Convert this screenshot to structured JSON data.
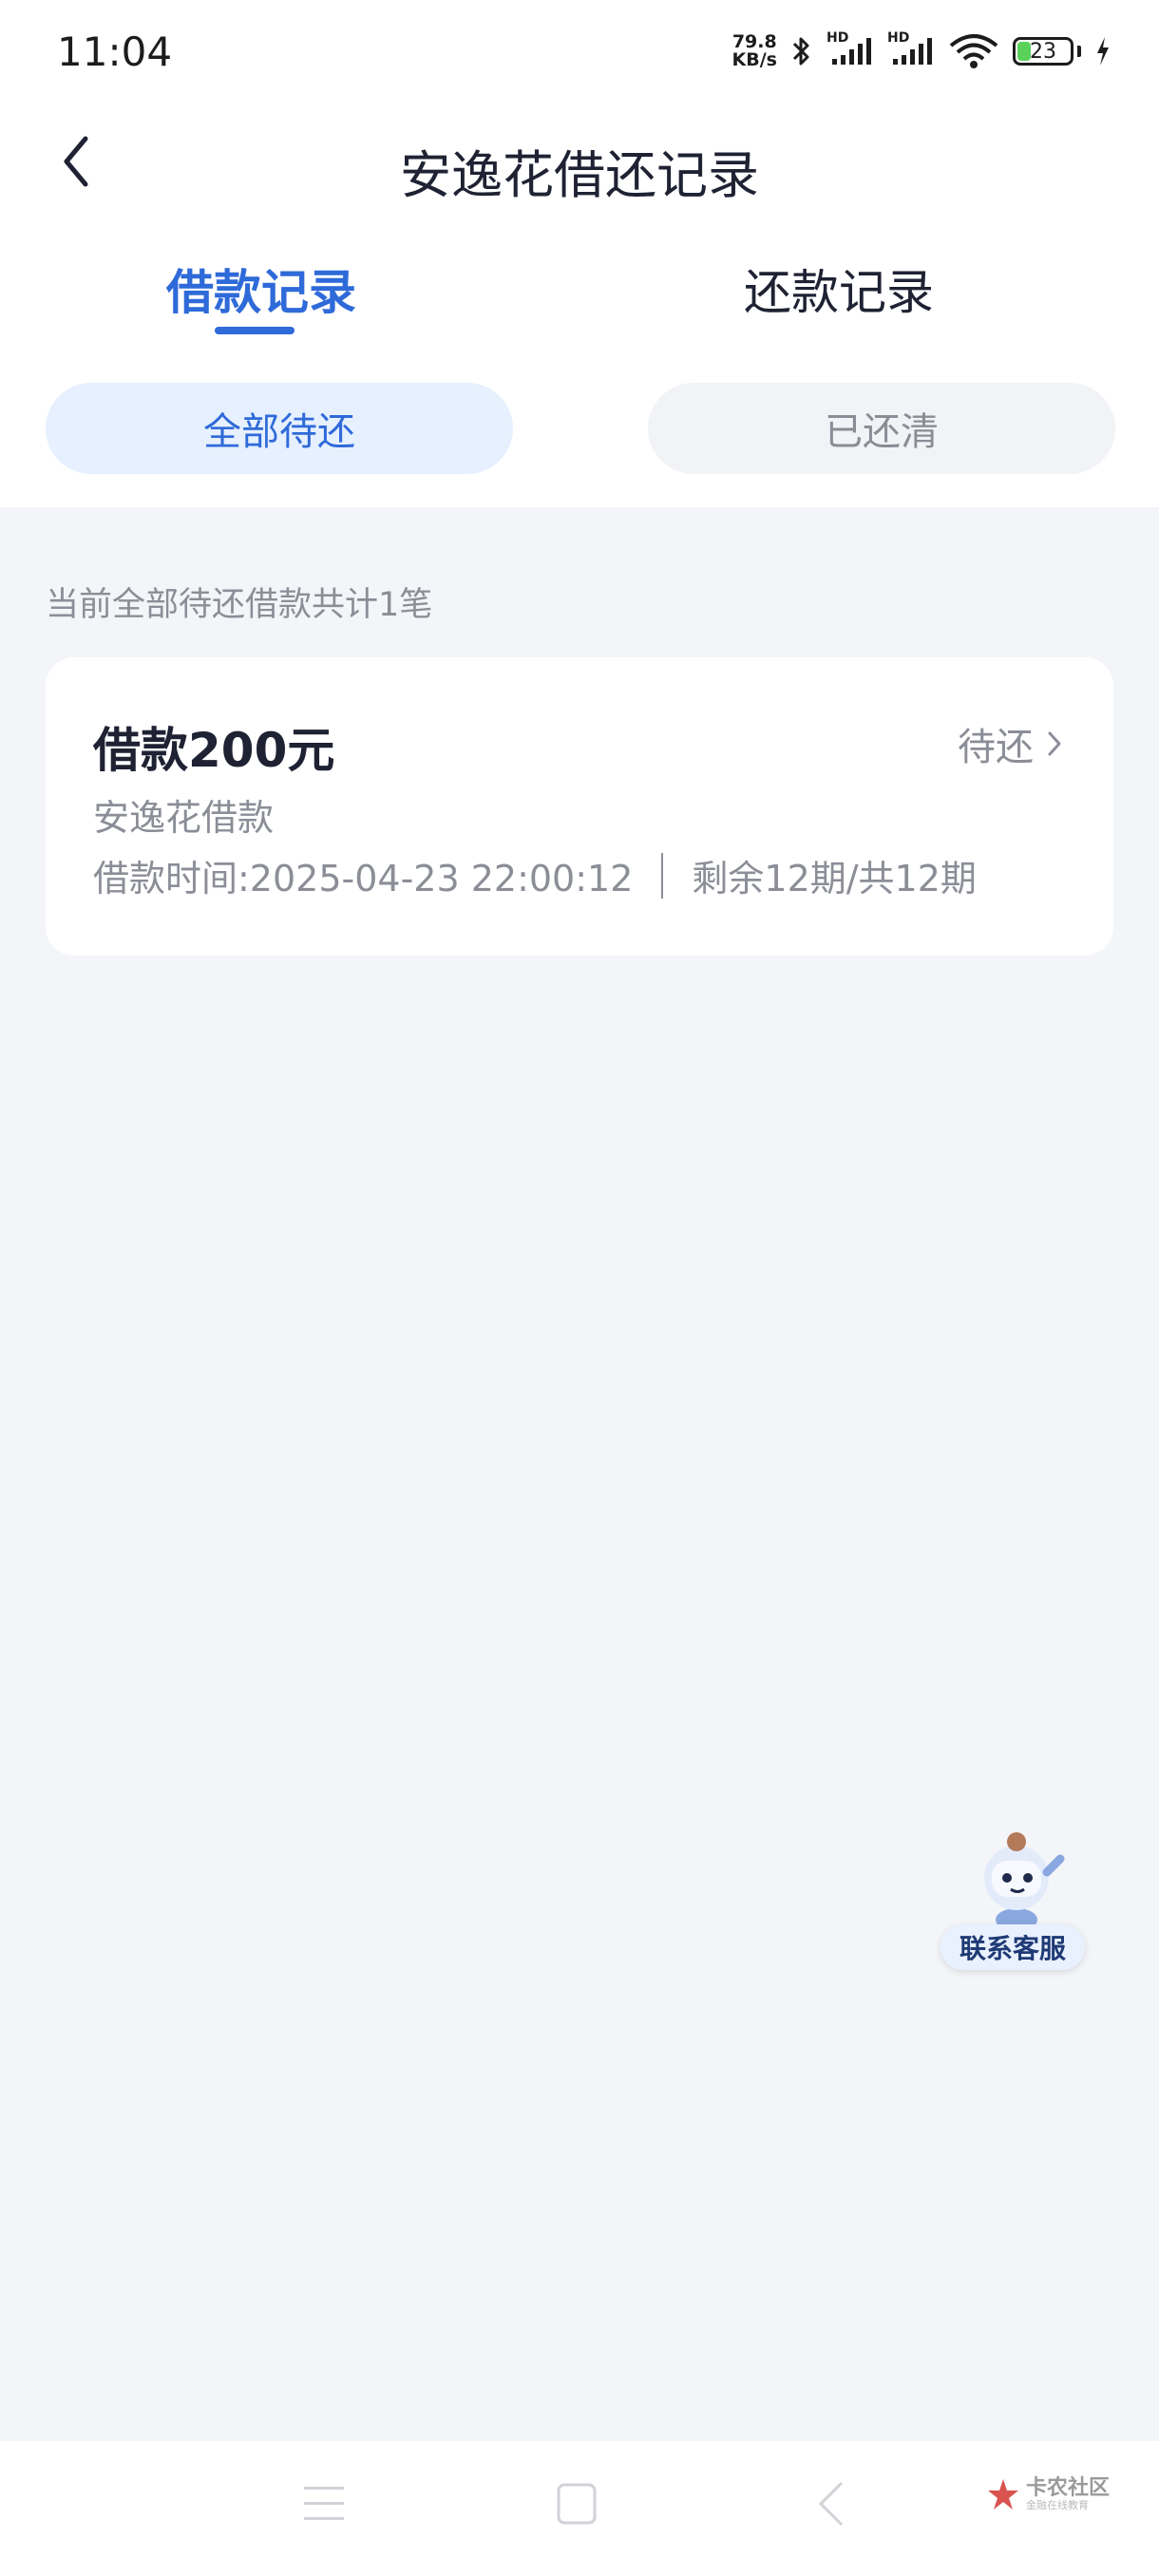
{
  "status_bar": {
    "time": "11:04",
    "net_speed_value": "79.8",
    "net_speed_unit": "KB/s",
    "network_type": "HD",
    "battery_level": "23",
    "battery_color": "#5ad25a"
  },
  "header": {
    "title": "安逸花借还记录",
    "back_icon": "chevron-left-icon"
  },
  "tabs": [
    {
      "label": "借款记录",
      "active": true
    },
    {
      "label": "还款记录",
      "active": false
    }
  ],
  "filters": [
    {
      "label": "全部待还",
      "active": true
    },
    {
      "label": "已还清",
      "active": false
    }
  ],
  "summary_text": "当前全部待还借款共计1笔",
  "loan": {
    "amount": "借款200元",
    "status": "待还",
    "product": "安逸花借款",
    "time": "借款时间:2025-04-23 22:00:12",
    "periods": "剩余12期/共12期"
  },
  "service": {
    "label": "联系客服"
  },
  "watermark": {
    "name": "卡农社区",
    "subtitle": "金融在线教育"
  },
  "colors": {
    "accent": "#2f6ad9",
    "background": "#f4f5f8"
  }
}
